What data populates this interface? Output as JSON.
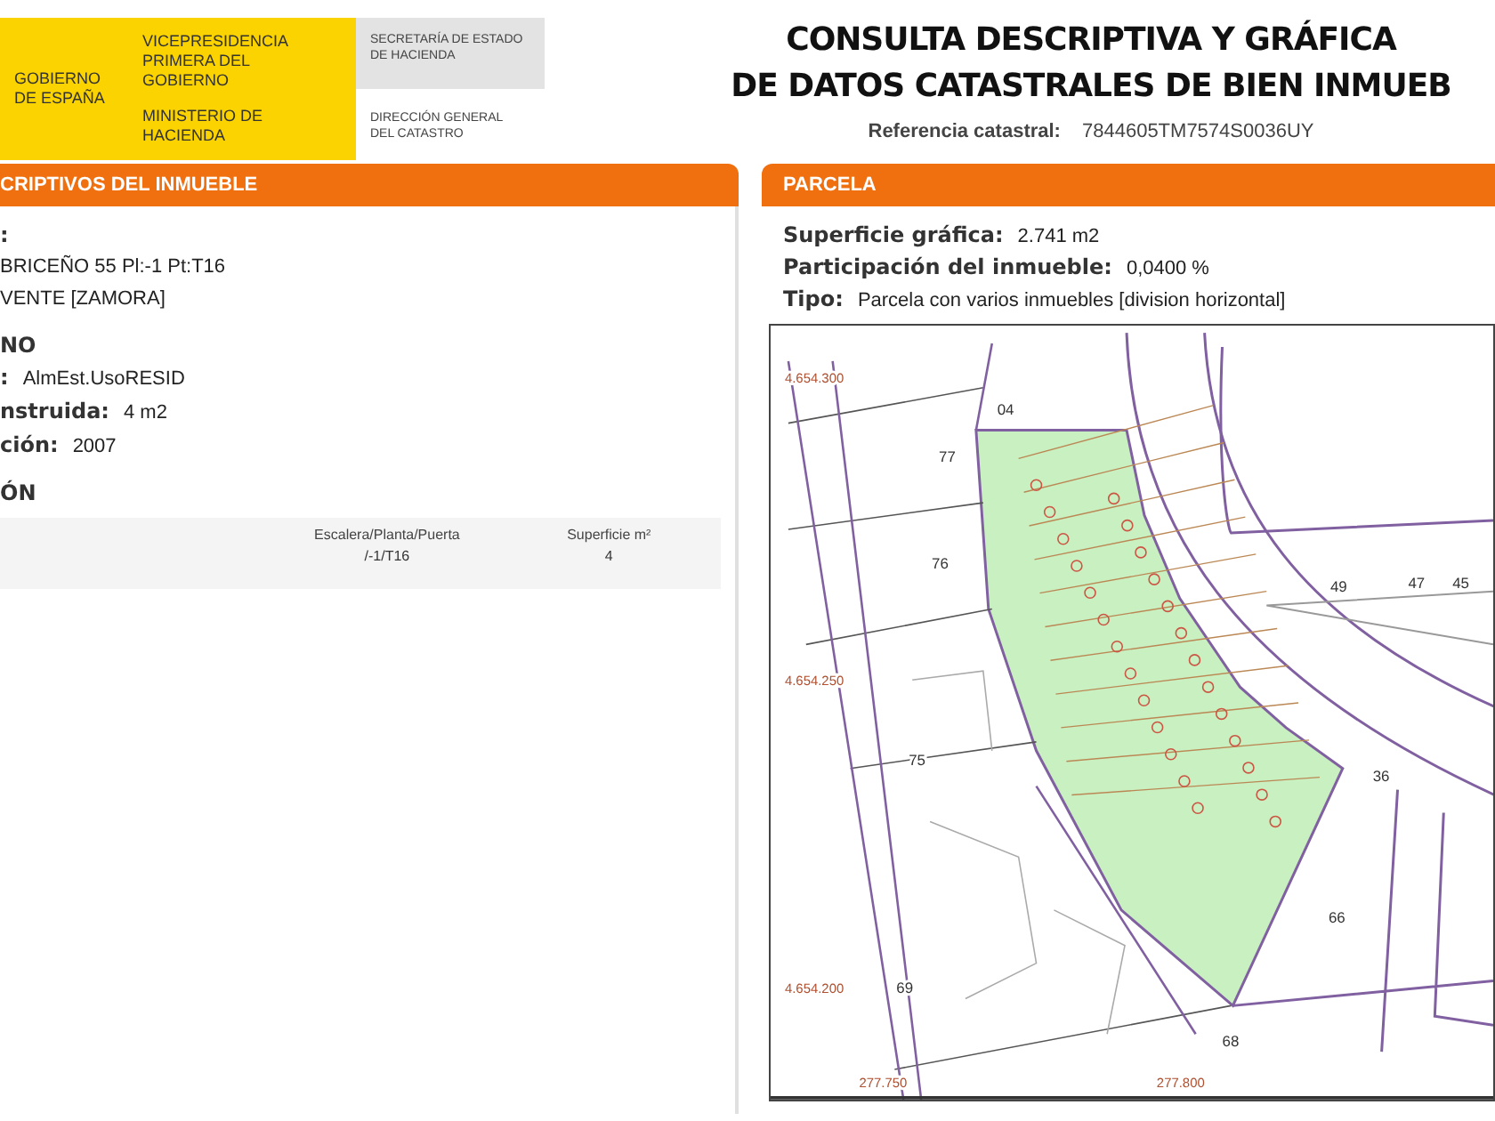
{
  "header": {
    "government": "GOBIERNO DE ESPAÑA",
    "vicepresidency": "VICEPRESIDENCIA PRIMERA DEL GOBIERNO",
    "ministry": "MINISTERIO DE HACIENDA",
    "secretariat": "SECRETARÍA DE ESTADO DE HACIENDA",
    "directorate": "DIRECCIÓN GENERAL DEL CATASTRO"
  },
  "title": {
    "line_1": "CONSULTA DESCRIPTIVA Y GRÁFICA",
    "line_2": "DE DATOS CATASTRALES DE BIEN INMUEB",
    "reference_label": "Referencia catastral:",
    "reference_value": "7844605TM7574S0036UY"
  },
  "left_section": {
    "heading": "CRIPTIVOS DEL INMUEBLE",
    "lines": [
      {
        "kind": "field",
        "label": ":"
      },
      {
        "kind": "field",
        "value": "BRICEÑO 55 Pl:-1 Pt:T16"
      },
      {
        "kind": "field",
        "value": "VENTE [ZAMORA]"
      },
      {
        "kind": "heading",
        "label": "NO"
      },
      {
        "kind": "field",
        "label": ":",
        "value": "AlmEst.UsoRESID"
      },
      {
        "kind": "field",
        "label": "nstruida:",
        "value": "4 m2"
      },
      {
        "kind": "field",
        "label": "ción:",
        "value": "2007"
      },
      {
        "kind": "heading",
        "label": "ÓN"
      }
    ],
    "table": {
      "columns": [
        "Escalera/Planta/Puerta",
        "Superficie m²"
      ],
      "rows": [
        [
          "/-1/T16",
          "4"
        ]
      ]
    }
  },
  "right_section": {
    "heading": "PARCELA",
    "fields": [
      {
        "label": "Superficie gráfica:",
        "value": "2.741 m2"
      },
      {
        "label": "Participación del inmueble:",
        "value": "0,0400 %"
      },
      {
        "label": "Tipo:",
        "value": "Parcela con varios inmuebles [division horizontal]"
      }
    ],
    "map_labels": [
      {
        "kind": "parcel",
        "text": "04"
      },
      {
        "kind": "parcel",
        "text": "77"
      },
      {
        "kind": "parcel",
        "text": "76"
      },
      {
        "kind": "parcel",
        "text": "75"
      },
      {
        "kind": "parcel",
        "text": "69"
      },
      {
        "kind": "parcel",
        "text": "68"
      },
      {
        "kind": "parcel",
        "text": "66"
      },
      {
        "kind": "parcel",
        "text": "49"
      },
      {
        "kind": "parcel",
        "text": "47"
      },
      {
        "kind": "parcel",
        "text": "45"
      },
      {
        "kind": "parcel",
        "text": "36"
      },
      {
        "kind": "coordinate",
        "text": "4.654.300"
      },
      {
        "kind": "coordinate",
        "text": "4.654.250"
      },
      {
        "kind": "coordinate",
        "text": "4.654.200"
      },
      {
        "kind": "coordinate",
        "text": "277.750"
      },
      {
        "kind": "coordinate",
        "text": "277.800"
      }
    ]
  }
}
